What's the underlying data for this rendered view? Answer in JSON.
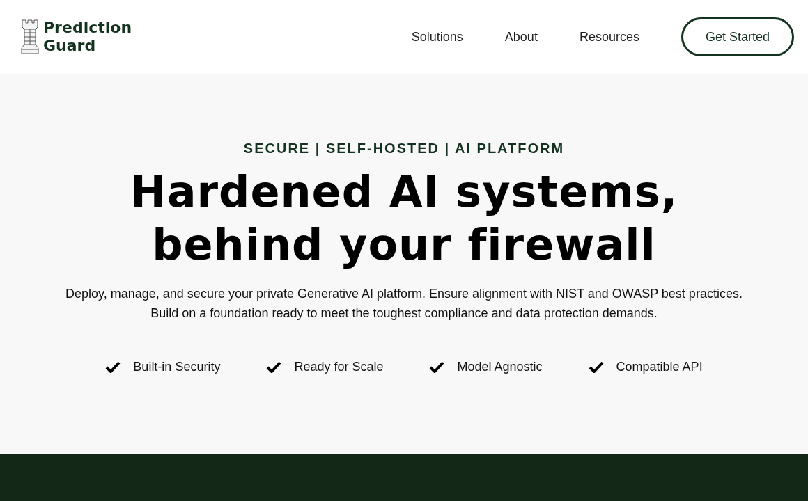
{
  "header": {
    "logo": {
      "lines": [
        "Prediction",
        "Guard"
      ]
    },
    "nav": [
      {
        "label": "Solutions"
      },
      {
        "label": "About"
      },
      {
        "label": "Resources"
      }
    ],
    "cta": "Get Started"
  },
  "hero": {
    "eyebrow": "SECURE | SELF-HOSTED | AI PLATFORM",
    "title_lines": [
      "Hardened AI systems,",
      "behind your firewall"
    ],
    "description": "Deploy, manage, and secure your private Generative AI platform. Ensure alignment with NIST and OWASP best practices. Build on a foundation ready to meet the toughest compliance and data protection demands.",
    "features": [
      "Built-in Security",
      "Ready for Scale",
      "Model Agnostic",
      "Compatible API"
    ]
  }
}
